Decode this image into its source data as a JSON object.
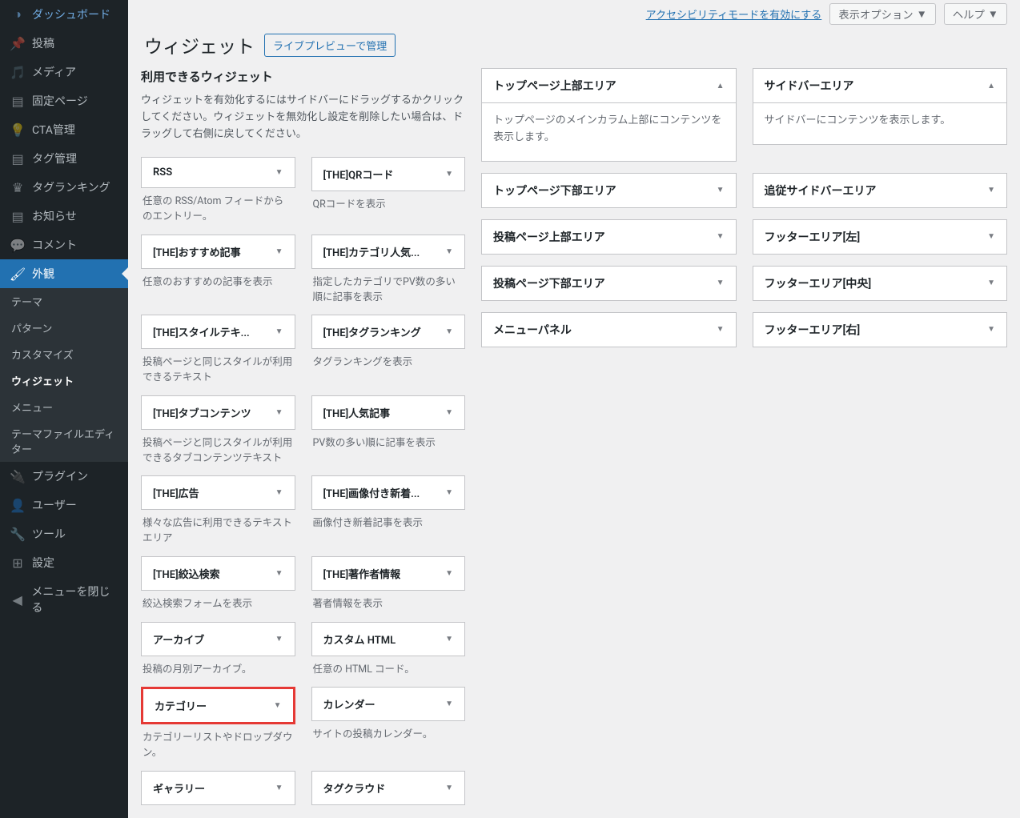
{
  "topbar": {
    "a11y_link": "アクセシビリティモードを有効にする",
    "screen_options": "表示オプション",
    "help": "ヘルプ"
  },
  "page": {
    "title": "ウィジェット",
    "live_preview_btn": "ライブプレビューで管理"
  },
  "sidebar": {
    "dashboard": "ダッシュボード",
    "posts": "投稿",
    "media": "メディア",
    "pages": "固定ページ",
    "cta": "CTA管理",
    "tags": "タグ管理",
    "tag_ranking": "タグランキング",
    "notice": "お知らせ",
    "comments": "コメント",
    "appearance": "外観",
    "plugins": "プラグイン",
    "users": "ユーザー",
    "tools": "ツール",
    "settings": "設定",
    "collapse": "メニューを閉じる",
    "submenu": {
      "themes": "テーマ",
      "patterns": "パターン",
      "customize": "カスタマイズ",
      "widgets": "ウィジェット",
      "menus": "メニュー",
      "editor": "テーマファイルエディター"
    }
  },
  "available": {
    "title": "利用できるウィジェット",
    "desc": "ウィジェットを有効化するにはサイドバーにドラッグするかクリックしてください。ウィジェットを無効化し設定を削除したい場合は、ドラッグして右側に戻してください。",
    "widgets": [
      {
        "title": "RSS",
        "desc": "任意の RSS/Atom フィードからのエントリー。"
      },
      {
        "title": "[THE]QRコード",
        "desc": "QRコードを表示"
      },
      {
        "title": "[THE]おすすめ記事",
        "desc": "任意のおすすめの記事を表示"
      },
      {
        "title": "[THE]カテゴリ人気...",
        "desc": "指定したカテゴリでPV数の多い順に記事を表示"
      },
      {
        "title": "[THE]スタイルテキ...",
        "desc": "投稿ページと同じスタイルが利用できるテキスト"
      },
      {
        "title": "[THE]タグランキング",
        "desc": "タグランキングを表示"
      },
      {
        "title": "[THE]タブコンテンツ",
        "desc": "投稿ページと同じスタイルが利用できるタブコンテンツテキスト"
      },
      {
        "title": "[THE]人気記事",
        "desc": "PV数の多い順に記事を表示"
      },
      {
        "title": "[THE]広告",
        "desc": "様々な広告に利用できるテキストエリア"
      },
      {
        "title": "[THE]画像付き新着...",
        "desc": "画像付き新着記事を表示"
      },
      {
        "title": "[THE]絞込検索",
        "desc": "絞込検索フォームを表示"
      },
      {
        "title": "[THE]著作者情報",
        "desc": "著者情報を表示"
      },
      {
        "title": "アーカイブ",
        "desc": "投稿の月別アーカイブ。"
      },
      {
        "title": "カスタム HTML",
        "desc": "任意の HTML コード。"
      },
      {
        "title": "カテゴリー",
        "desc": "カテゴリーリストやドロップダウン。",
        "highlighted": true
      },
      {
        "title": "カレンダー",
        "desc": "サイトの投稿カレンダー。"
      },
      {
        "title": "ギャラリー",
        "desc": ""
      },
      {
        "title": "タグクラウド",
        "desc": ""
      }
    ]
  },
  "areas": [
    {
      "title": "トップページ上部エリア",
      "desc": "トップページのメインカラム上部にコンテンツを表示します。",
      "expanded": true,
      "caret": "▲"
    },
    {
      "title": "サイドバーエリア",
      "desc": "サイドバーにコンテンツを表示します。",
      "expanded": true,
      "caret": "▲"
    },
    {
      "title": "トップページ下部エリア",
      "expanded": false,
      "caret": "▼"
    },
    {
      "title": "追従サイドバーエリア",
      "expanded": false,
      "caret": "▼"
    },
    {
      "title": "投稿ページ上部エリア",
      "expanded": false,
      "caret": "▼"
    },
    {
      "title": "フッターエリア[左]",
      "expanded": false,
      "caret": "▼"
    },
    {
      "title": "投稿ページ下部エリア",
      "expanded": false,
      "caret": "▼"
    },
    {
      "title": "フッターエリア[中央]",
      "expanded": false,
      "caret": "▼"
    },
    {
      "title": "メニューパネル",
      "expanded": false,
      "caret": "▼"
    },
    {
      "title": "フッターエリア[右]",
      "expanded": false,
      "caret": "▼"
    }
  ]
}
